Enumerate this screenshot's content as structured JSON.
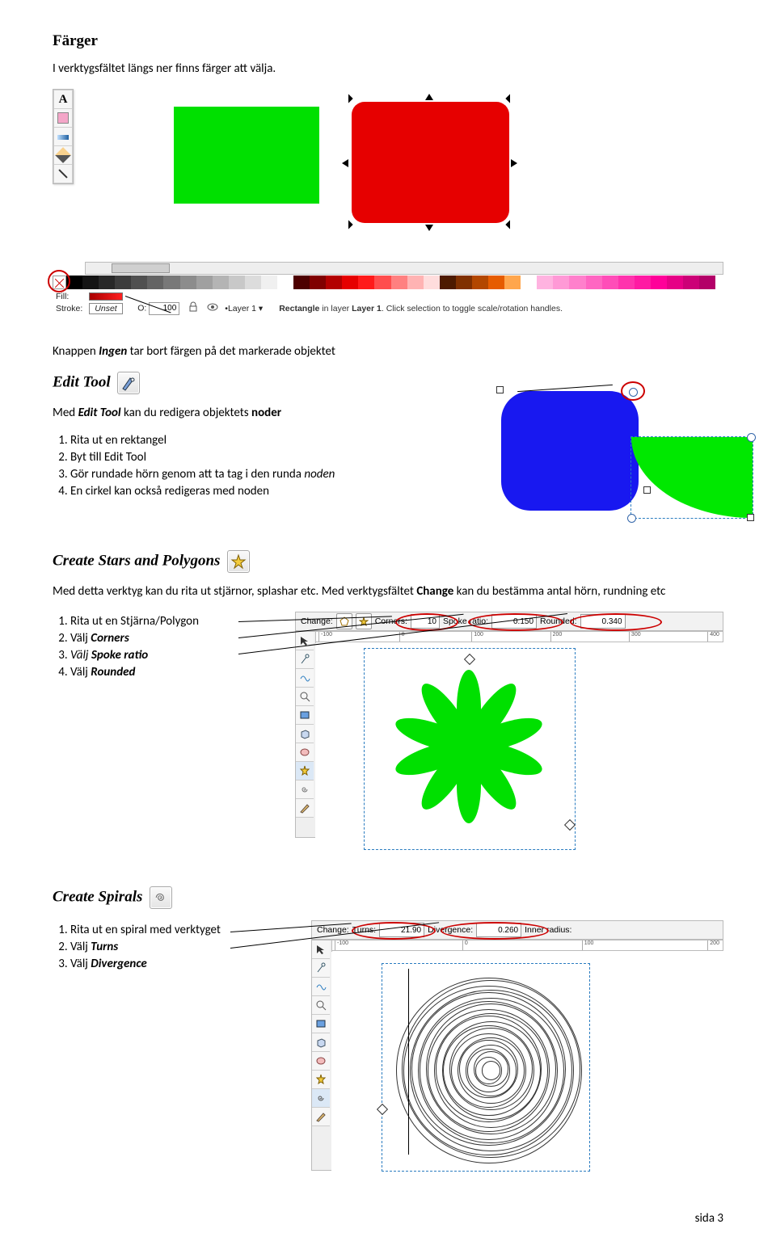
{
  "section1": {
    "title": "Färger",
    "intro": "I verktygsfältet längs ner finns färger att välja.",
    "knappen_pre": "Knappen ",
    "knappen_bold": "Ingen",
    "knappen_post": " tar bort färgen på det markerade objektet"
  },
  "shot1": {
    "fill_label": "Fill:",
    "stroke_label": "Stroke:",
    "unset": "Unset",
    "o_label": "O:",
    "o_value": "100",
    "layer_label": "Layer 1",
    "status_pre": "Rectangle",
    "status_mid": " in layer ",
    "status_layer": "Layer 1",
    "status_post": ". Click selection to toggle scale/rotation handles.",
    "palette": [
      "#000000",
      "#141414",
      "#282828",
      "#3c3c3c",
      "#505050",
      "#646464",
      "#787878",
      "#8c8c8c",
      "#a0a0a0",
      "#b4b4b4",
      "#c8c8c8",
      "#dcdcdc",
      "#f0f0f0",
      "#ffffff",
      "#4d0000",
      "#800000",
      "#b30000",
      "#e60000",
      "#ff1a1a",
      "#ff4d4d",
      "#ff8080",
      "#ffb3b3",
      "#ffdddd",
      "#4d1a00",
      "#803000",
      "#b34700",
      "#e65c00",
      "#ffa64d",
      "#ffffff",
      "#ffb3e0",
      "#ff99d6",
      "#ff80cc",
      "#ff66c2",
      "#ff4db8",
      "#ff33ad",
      "#ff1aa3",
      "#ff0099",
      "#e60086",
      "#cc0077",
      "#b30068"
    ]
  },
  "section2": {
    "title": "Edit Tool",
    "intro_pre": "Med ",
    "intro_bold": "Edit Tool",
    "intro_mid": " kan du redigera objektets ",
    "intro_bold2": "noder",
    "steps": [
      "Rita ut en rektangel",
      "Byt till Edit Tool",
      "Gör rundade hörn genom att ta tag i den runda ",
      "En cirkel kan också redigeras med noden"
    ],
    "step3_noden": "noden"
  },
  "section3": {
    "title": "Create Stars and Polygons",
    "intro_pre": "Med detta verktyg kan du rita ut stjärnor, splashar etc. Med verktygsfältet ",
    "intro_bold": "Change",
    "intro_post": " kan du bestämma antal hörn, rundning etc",
    "steps": {
      "s1": "Rita ut en Stjärna/Polygon",
      "s2_pre": "Välj ",
      "s2_bold": "Corners",
      "s3_pre": "Välj ",
      "s3_bold": "Spoke ratio",
      "s4_pre": "Välj ",
      "s4_bold": "Rounded"
    }
  },
  "shot3": {
    "change": "Change:",
    "corners_label": "Corners:",
    "corners_value": "10",
    "spoke_label": "Spoke ratio:",
    "spoke_value": "0.150",
    "rounded_label": "Rounded:",
    "rounded_value": "0.340",
    "ruler_ticks": [
      "-100",
      "0",
      "100",
      "200",
      "300",
      "400"
    ]
  },
  "section4": {
    "title": "Create Spirals",
    "steps": {
      "s1": "Rita ut en spiral med verktyget",
      "s2_pre": "Välj ",
      "s2_bold": "Turns",
      "s3_pre": "Välj ",
      "s3_bold": "Divergence"
    }
  },
  "shot4": {
    "change": "Change:",
    "turns_label": "Turns:",
    "turns_value": "21.90",
    "div_label": "Divergence:",
    "div_value": "0.260",
    "inner_label": "Inner radius:",
    "ruler_ticks": [
      "-100",
      "0",
      "100",
      "200"
    ]
  },
  "footer": "sida 3"
}
